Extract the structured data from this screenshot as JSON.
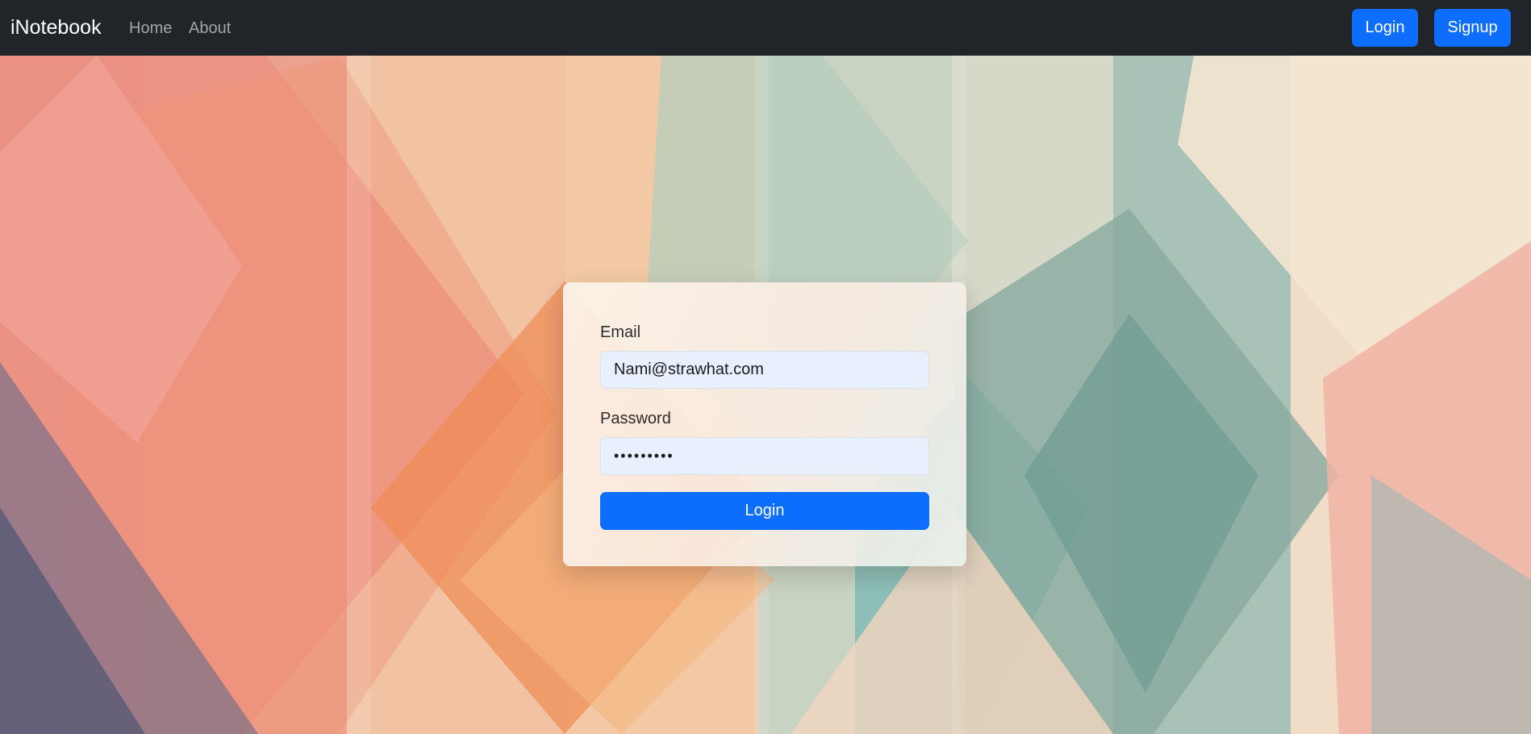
{
  "navbar": {
    "brand": "iNotebook",
    "links": [
      "Home",
      "About"
    ],
    "login_label": "Login",
    "signup_label": "Signup"
  },
  "form": {
    "email_label": "Email",
    "email_value": "Nami@strawhat.com",
    "password_label": "Password",
    "password_value": "•••••••••",
    "submit_label": "Login"
  },
  "colors": {
    "navbar_bg": "#212529",
    "primary": "#0d6efd",
    "input_bg": "#e8f0fe"
  }
}
